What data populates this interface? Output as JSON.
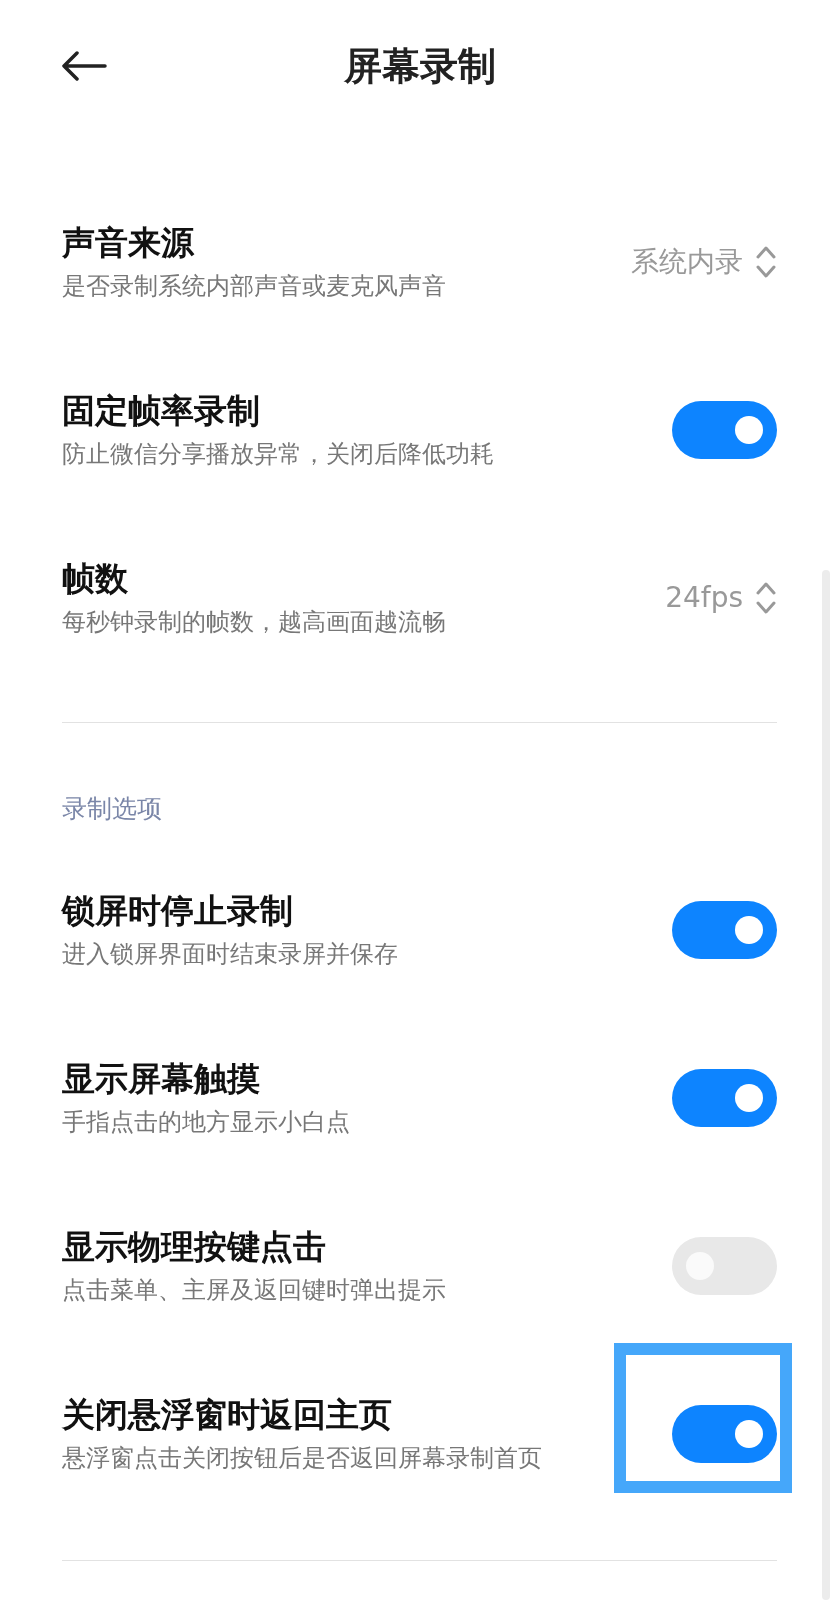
{
  "header": {
    "title": "屏幕录制"
  },
  "groups": [
    {
      "items": [
        {
          "kind": "select",
          "title": "声音来源",
          "subtitle": "是否录制系统内部声音或麦克风声音",
          "value": "系统内录"
        },
        {
          "kind": "toggle",
          "title": "固定帧率录制",
          "subtitle": "防止微信分享播放异常，关闭后降低功耗",
          "on": true
        },
        {
          "kind": "select",
          "title": "帧数",
          "subtitle": "每秒钟录制的帧数，越高画面越流畅",
          "value": "24fps"
        }
      ]
    },
    {
      "label": "录制选项",
      "items": [
        {
          "kind": "toggle",
          "title": "锁屏时停止录制",
          "subtitle": "进入锁屏界面时结束录屏并保存",
          "on": true
        },
        {
          "kind": "toggle",
          "title": "显示屏幕触摸",
          "subtitle": "手指点击的地方显示小白点",
          "on": true
        },
        {
          "kind": "toggle",
          "title": "显示物理按键点击",
          "subtitle": "点击菜单、主屏及返回键时弹出提示",
          "on": false
        },
        {
          "kind": "toggle",
          "title": "关闭悬浮窗时返回主页",
          "subtitle": "悬浮窗点击关闭按钮后是否返回屏幕录制首页",
          "on": true,
          "highlighted": true
        }
      ]
    }
  ]
}
